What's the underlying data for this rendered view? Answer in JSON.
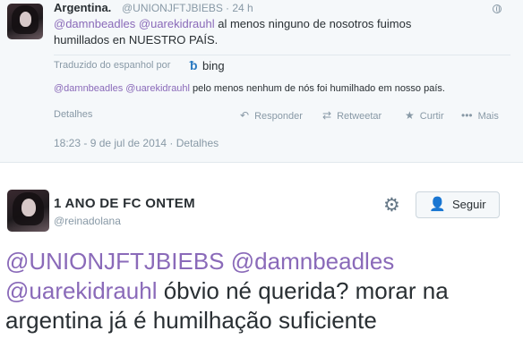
{
  "tweet1": {
    "name": "Argentina.",
    "handle": "@UNIONJFTJBIEBS",
    "time": "· 24 h",
    "mention1": "@damnbeadles",
    "mention2": "@uarekidrauhl",
    "text_rest": " al menos ninguno de nosotros fuimos humillados en NUESTRO PAÍS.",
    "translated_label": "Traduzido do espanhol por",
    "bing_label": "bing",
    "translation_rest": " pelo menos nenhum de nós foi humilhado em nosso país.",
    "details": "Detalhes",
    "actions": {
      "reply": "Responder",
      "retweet": "Retweetar",
      "favorite": "Curtir",
      "more": "Mais"
    },
    "timestamp": "18:23 - 9 de jul de 2014 · Detalhes"
  },
  "tweet2": {
    "name": "1 ANO DE FC ONTEM",
    "handle": "@reinadolana",
    "follow_label": "Seguir",
    "mention1": "@UNIONJFTJBIEBS",
    "mention2": "@damnbeadles",
    "mention3": "@uarekidrauhl",
    "text_rest": " óbvio né querida? morar na argentina já é humilhação suficiente"
  },
  "icons": {
    "globe": "globe-icon",
    "reply": "reply-icon",
    "retweet": "retweet-icon",
    "favorite": "star-icon",
    "more": "more-dots-icon",
    "gear": "gear-icon",
    "add_user": "add-user-icon",
    "bing": "bing-logo-icon"
  },
  "colors": {
    "mention": "#8a6ab9",
    "muted": "#8899a6",
    "text": "#292f33",
    "follow_icon": "#55acee"
  }
}
